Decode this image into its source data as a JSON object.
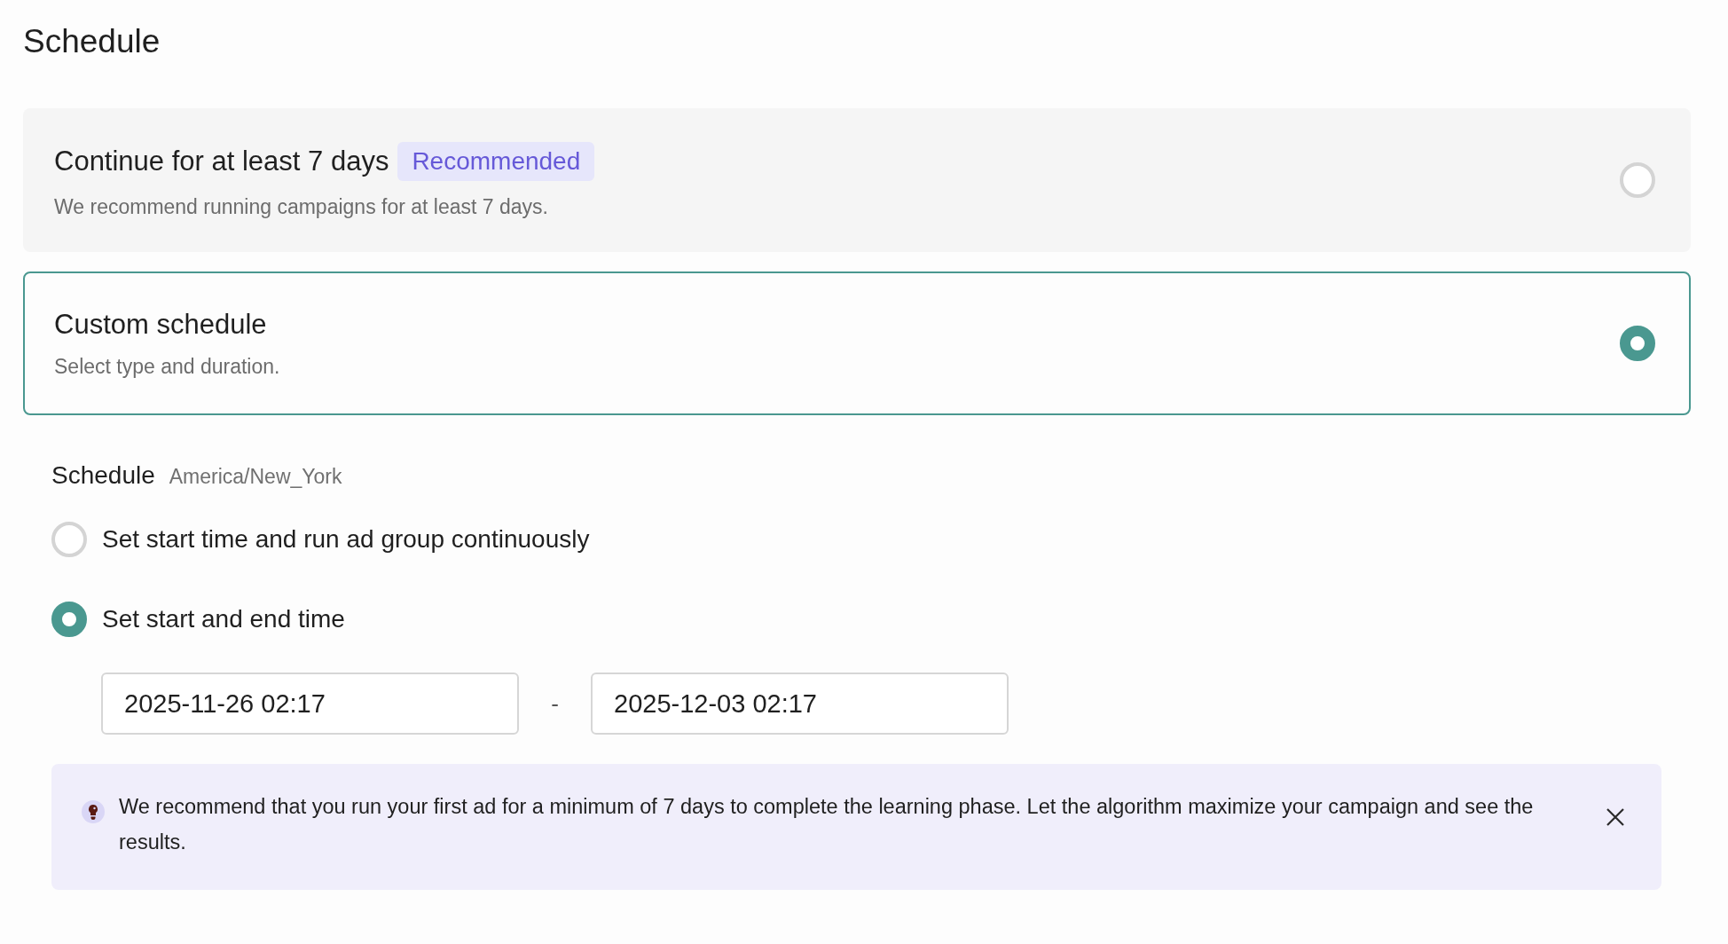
{
  "title": "Schedule",
  "options": [
    {
      "title": "Continue for at least 7 days",
      "badge": "Recommended",
      "description": "We recommend running campaigns for at least 7 days.",
      "selected": false
    },
    {
      "title": "Custom schedule",
      "description": "Select type and duration.",
      "selected": true
    }
  ],
  "schedule": {
    "label": "Schedule",
    "timezone": "America/New_York",
    "choices": [
      {
        "label": "Set start time and run ad group continuously",
        "selected": false
      },
      {
        "label": "Set start and end time",
        "selected": true
      }
    ],
    "start": "2025-11-26 02:17",
    "separator": "-",
    "end": "2025-12-03 02:17"
  },
  "notice": {
    "text": "We recommend that you run your first ad for a minimum of 7 days to complete the learning phase. Let the algorithm maximize your campaign and see the results."
  }
}
